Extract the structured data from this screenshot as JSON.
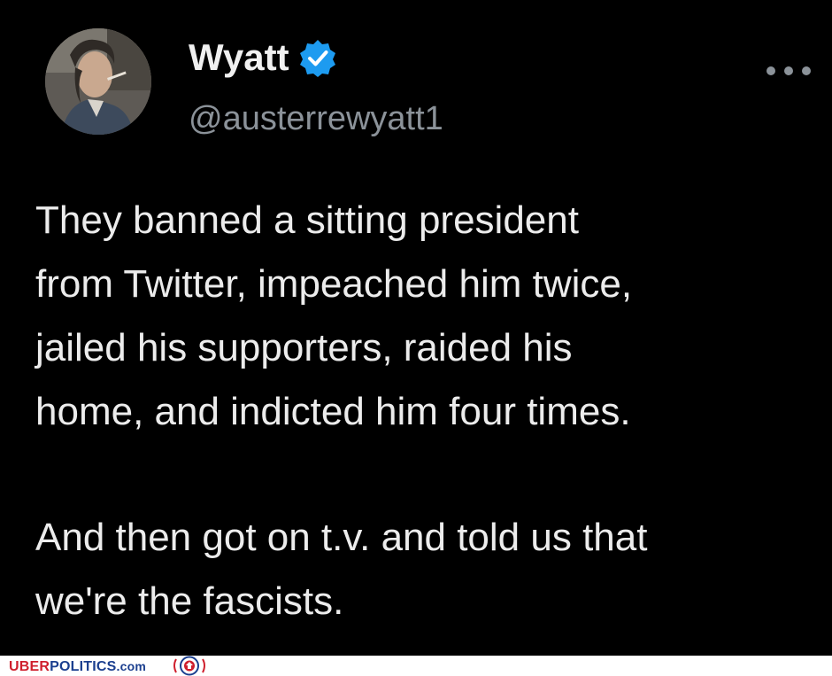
{
  "tweet": {
    "display_name": "Wyatt",
    "handle": "@austerrewyatt1",
    "verified": true,
    "paragraphs": [
      [
        "They banned a sitting president",
        "from Twitter, impeached him twice,",
        "jailed his supporters, raided his",
        "home, and indicted him four times."
      ],
      [
        "And then got on t.v. and told us that",
        "we're the fascists."
      ]
    ]
  },
  "watermark": {
    "part1": "UBER",
    "part2": "POLITICS",
    "part3": ".com"
  },
  "colors": {
    "background": "#000000",
    "text": "#ececec",
    "handle": "#8b9299",
    "verified_badge": "#1d9bf0",
    "brand_red": "#cf1f2d",
    "brand_blue": "#1b3f8f"
  },
  "icons": {
    "verified": "verified-badge-icon",
    "more": "more-dots-icon",
    "watermark_logo": "shield-logo-icon"
  }
}
